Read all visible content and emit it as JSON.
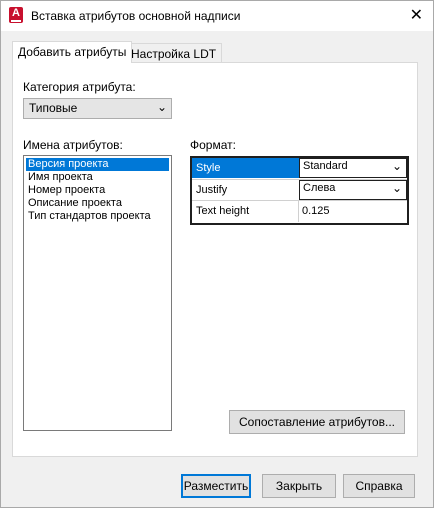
{
  "window": {
    "title": "Вставка атрибутов основной надписи"
  },
  "tabs": [
    {
      "label": "Добавить атрибуты"
    },
    {
      "label": "Настройка LDT"
    }
  ],
  "category": {
    "label": "Категория атрибута:",
    "selected": "Типовые"
  },
  "names": {
    "label": "Имена атрибутов:",
    "items": [
      "Версия проекта",
      "Имя проекта",
      "Номер проекта",
      "Описание проекта",
      "Тип стандартов проекта"
    ]
  },
  "format": {
    "label": "Формат:",
    "rows": [
      {
        "name": "Style",
        "value": "Standard"
      },
      {
        "name": "Justify",
        "value": "Слева"
      },
      {
        "name": "Text height",
        "value": "0.125"
      }
    ]
  },
  "buttons": {
    "mapping": "Сопоставление атрибутов...",
    "place": "Разместить",
    "close": "Закрыть",
    "help": "Справка"
  },
  "icons": {
    "app": "autocad-app-icon",
    "close": "close-icon",
    "chevron": "chevron-down-icon"
  }
}
